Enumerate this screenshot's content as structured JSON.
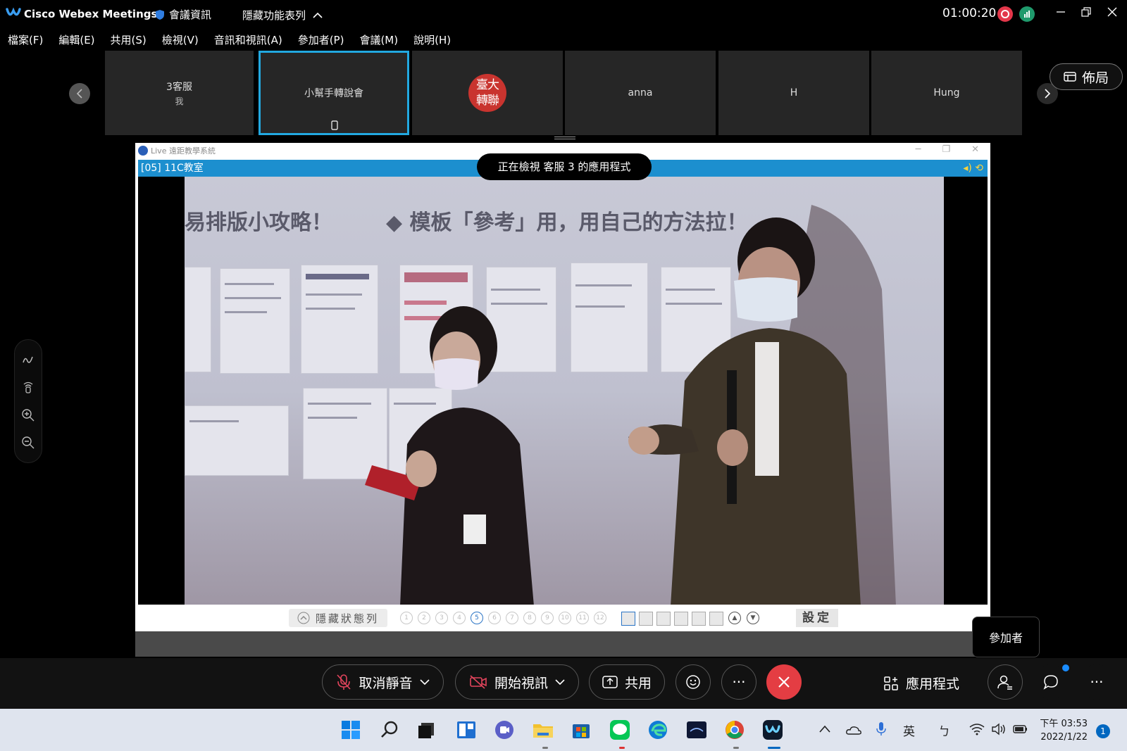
{
  "window": {
    "app_title": "Cisco Webex Meetings",
    "meeting_info_label": "會議資訊",
    "hide_menu_label": "隱藏功能表列",
    "timer": "01:00:20"
  },
  "menu": [
    "檔案(F)",
    "編輯(E)",
    "共用(S)",
    "檢視(V)",
    "音訊和視訊(A)",
    "參加者(P)",
    "會議(M)",
    "說明(H)"
  ],
  "participants": {
    "tiles": [
      {
        "name": "3客服",
        "sub": "我"
      },
      {
        "name": "小幫手轉說會",
        "sub": ""
      },
      {
        "name": "",
        "sub": ""
      },
      {
        "name": "anna",
        "sub": ""
      },
      {
        "name": "H",
        "sub": ""
      },
      {
        "name": "Hung",
        "sub": ""
      }
    ],
    "seal_text": "臺大轉聯",
    "layout_label": "佈局"
  },
  "share": {
    "window_title": "Live 遠距教學系統",
    "classroom": "[05] 11C教室",
    "viewing_toast": "正在檢視 客服 3 的應用程式",
    "slide_heading_left": "易排版小攻略！",
    "slide_heading_right": "◆ 模板「參考」用，用自己的方法拉！",
    "status_toggle_label": "隱藏狀態列",
    "page_numbers": [
      "1",
      "2",
      "3",
      "4",
      "5",
      "6",
      "7",
      "8",
      "9",
      "10",
      "11",
      "12"
    ],
    "selected_page": "5",
    "settings_label": "設定"
  },
  "tooltip": {
    "participants": "參加者"
  },
  "controls": {
    "unmute": "取消靜音",
    "start_video": "開始視訊",
    "share": "共用",
    "apps": "應用程式"
  },
  "taskbar": {
    "ime": "英",
    "ime2": "ㄅ",
    "time": "下午 03:53",
    "date": "2022/1/22",
    "notification_count": "1"
  },
  "colors": {
    "accent_active_tile": "#22a8e0",
    "end_call": "#e43d43",
    "class_bar": "#1c8fcf"
  }
}
